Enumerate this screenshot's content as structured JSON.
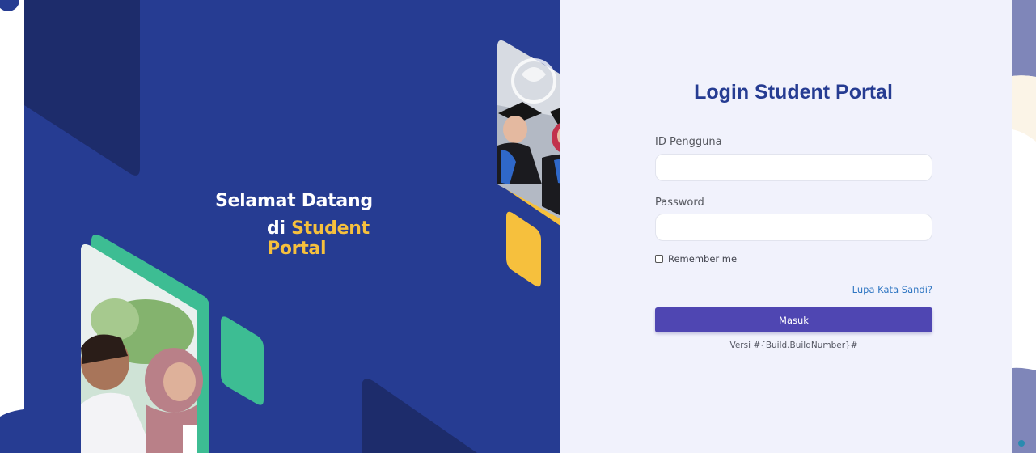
{
  "hero": {
    "welcome_line1": "Selamat Datang",
    "welcome_line2_prefix": "di ",
    "welcome_line2_highlight": "Student Portal"
  },
  "login": {
    "title": "Login Student Portal",
    "username_label": "ID Pengguna",
    "username_value": "",
    "password_label": "Password",
    "password_value": "",
    "remember_label": "Remember me",
    "forgot_link": "Lupa Kata Sandi?",
    "submit_label": "Masuk",
    "version_text": "Versi #{Build.BuildNumber}#"
  },
  "colors": {
    "hero_blue": "#263c92",
    "accent_yellow": "#f6c03d",
    "accent_green": "#3dbd93",
    "button_purple": "#4f46b2",
    "title_blue": "#263c92",
    "link_blue": "#2f76c2"
  }
}
